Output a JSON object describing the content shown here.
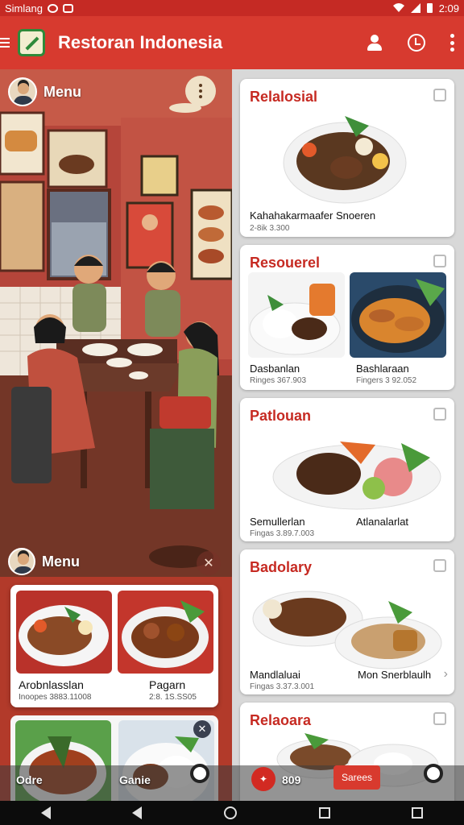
{
  "status_bar": {
    "carrier": "Simlang",
    "time": "2:09"
  },
  "app_bar": {
    "title": "Restoran Indonesia",
    "icons": [
      "menu-icon",
      "logo",
      "user-icon",
      "clock-icon",
      "more-vert-icon"
    ]
  },
  "left_panel": {
    "header_label": "Menu",
    "sub_label": "Menu",
    "cards": [
      {
        "title": "Arobnlasslan",
        "subtitle": "Inoopes 3883.11008"
      },
      {
        "title": "Pagarn",
        "subtitle": "2:8. 1S.SS05"
      }
    ]
  },
  "right_panel": {
    "cards": [
      {
        "title": "Relalosial",
        "items": [
          {
            "caption": "Kahahakarmaafer Snoeren",
            "sub": "2-8ik 3.300"
          }
        ]
      },
      {
        "title": "Resouerel",
        "items": [
          {
            "caption": "Dasbanlan",
            "sub": "Ringes 367.903"
          },
          {
            "caption": "Bashlaraan",
            "sub": "Fingers 3 92.052"
          }
        ]
      },
      {
        "title": "Patlouan",
        "items": [
          {
            "caption": "Semullerlan",
            "sub": "Fingas 3.89.7.003"
          },
          {
            "caption": "Atlanalarlat",
            "sub": ""
          }
        ]
      },
      {
        "title": "Badolary",
        "items": [
          {
            "caption": "Mandlaluai",
            "sub": "Fingas 3.37.3.001"
          },
          {
            "caption": "Mon Snerblaulh",
            "sub": ""
          }
        ]
      },
      {
        "title": "Relaoara",
        "items": []
      }
    ]
  },
  "bottom_bar": {
    "left_item_1": "Odre",
    "left_item_2": "Ganie",
    "right_item": "809",
    "action_button": "Sarees"
  },
  "colors": {
    "brand_red": "#d73a2f",
    "title_red": "#c62a22"
  }
}
